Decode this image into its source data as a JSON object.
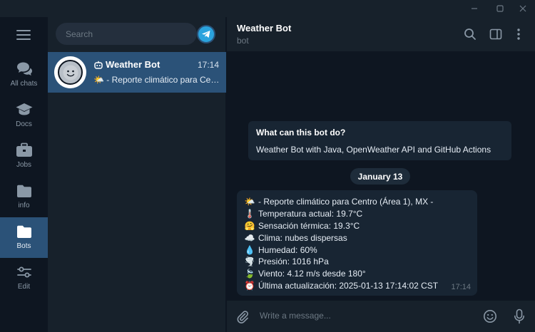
{
  "window": {
    "controls": [
      "minimize",
      "maximize",
      "close"
    ]
  },
  "rail": {
    "folders": [
      {
        "label": "All chats",
        "icon": "chats-icon"
      },
      {
        "label": "Docs",
        "icon": "graduation-cap-icon"
      },
      {
        "label": "Jobs",
        "icon": "briefcase-icon"
      },
      {
        "label": "info",
        "icon": "folder-icon"
      },
      {
        "label": "Bots",
        "icon": "folder-icon"
      },
      {
        "label": "Edit",
        "icon": "sliders-icon"
      }
    ],
    "active": "Bots"
  },
  "sidebar": {
    "search_placeholder": "Search",
    "chats": [
      {
        "title": "Weather Bot",
        "time": "17:14",
        "preview": "🌤️ - Reporte climático para Centro (Área 1), MX -"
      }
    ]
  },
  "chat": {
    "title": "Weather Bot",
    "subtitle": "bot",
    "intro": {
      "question": "What can this bot do?",
      "answer": "Weather Bot with Java, OpenWeather API and GitHub Actions"
    },
    "date": "January 13",
    "message": {
      "lines": [
        {
          "emoji": "🌤️",
          "text": "- Reporte climático para Centro (Área 1), MX -"
        },
        {
          "emoji": "🌡️",
          "text": "Temperatura actual: 19.7°C"
        },
        {
          "emoji": "🤗",
          "text": "Sensación térmica: 19.3°C"
        },
        {
          "emoji": "☁️",
          "text": "Clima: nubes dispersas"
        },
        {
          "emoji": "💧",
          "text": "Humedad: 60%"
        },
        {
          "emoji": "🌪️",
          "text": "Presión: 1016 hPa"
        },
        {
          "emoji": "🍃",
          "text": "Viento: 4.12 m/s desde 180°"
        },
        {
          "emoji": "⏰",
          "text": "Última actualización: 2025-01-13 17:14:02 CST"
        }
      ],
      "time": "17:14"
    },
    "composer_placeholder": "Write a message..."
  },
  "colors": {
    "accent": "#2b5278",
    "background": "#0e1621",
    "panel": "#17212b",
    "bubble": "#182533",
    "muted_text": "#6c7883"
  }
}
